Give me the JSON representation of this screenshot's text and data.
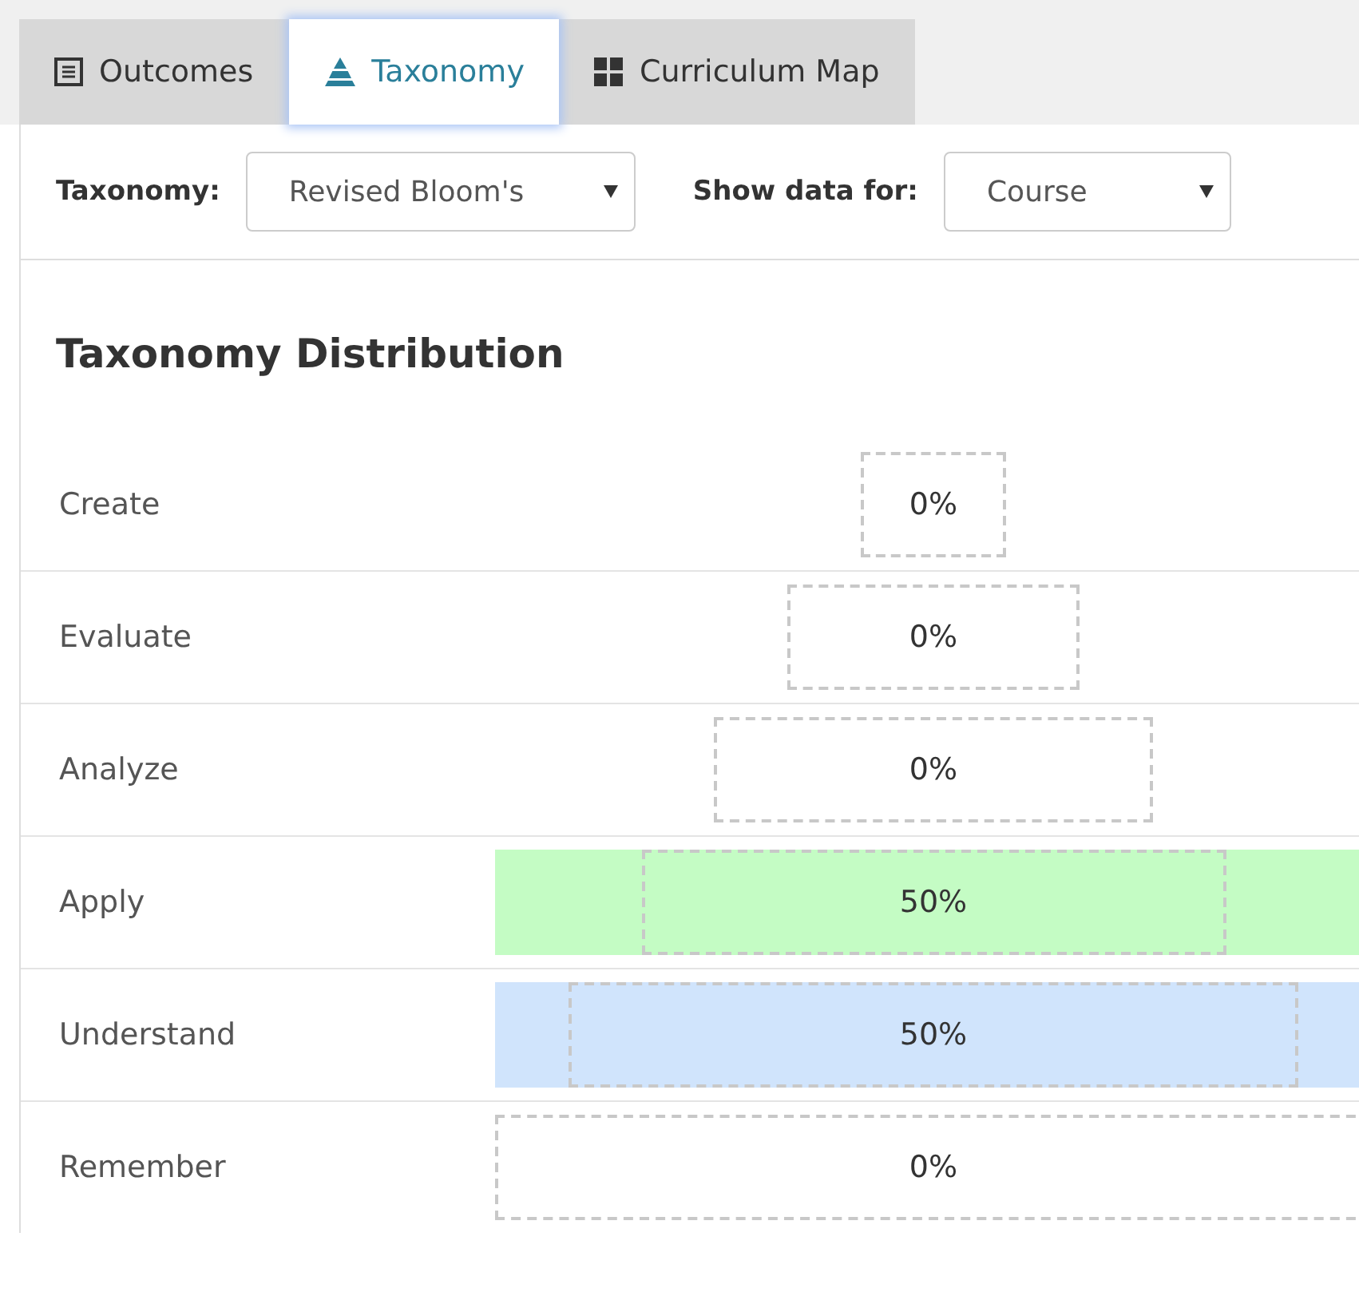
{
  "tabs": [
    {
      "label": "Outcomes",
      "selected": false
    },
    {
      "label": "Taxonomy",
      "selected": true
    },
    {
      "label": "Curriculum Map",
      "selected": false
    }
  ],
  "filters": [
    {
      "label": "Taxonomy:",
      "value": "Revised Bloom's"
    },
    {
      "label": "Show data for:",
      "value": "Course"
    }
  ],
  "title": "Taxonomy Distribution",
  "levels": [
    {
      "name": "Create",
      "value": "0%"
    },
    {
      "name": "Evaluate",
      "value": "0%"
    },
    {
      "name": "Analyze",
      "value": "0%"
    },
    {
      "name": "Apply",
      "value": "50%",
      "color": "#c4fcc4"
    },
    {
      "name": "Understand",
      "value": "50%",
      "color": "#d0e4fc"
    },
    {
      "name": "Remember",
      "value": "0%"
    }
  ]
}
